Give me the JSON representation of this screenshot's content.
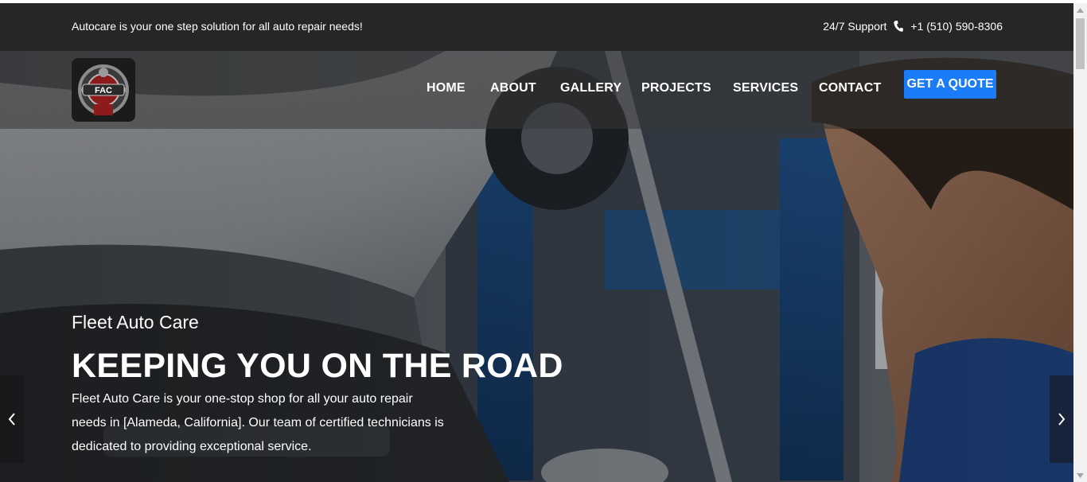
{
  "topbar": {
    "tagline": "Autocare is your one step solution for all auto repair needs!",
    "support_label": "24/7 Support",
    "phone": "+1 (510) 590-8306",
    "phone_icon": "phone-icon"
  },
  "header": {
    "logo_text": "FAC",
    "nav": {
      "home": "HOME",
      "about": "ABOUT",
      "gallery": "GALLERY",
      "projects": "PROJECTS",
      "services": "SERVICES",
      "contact": "CONTACT"
    },
    "cta": "GET A QUOTE"
  },
  "hero": {
    "kicker": "Fleet Auto Care",
    "headline": "KEEPING YOU ON THE ROAD",
    "description": "Fleet Auto Care is your one-stop shop for all your auto repair needs in [Alameda, California]. Our team of certified technicians is dedicated to providing exceptional service.",
    "prev_icon": "chevron-left-icon",
    "next_icon": "chevron-right-icon"
  },
  "colors": {
    "topbar_bg": "#262626",
    "cta_bg": "#1a7cf7",
    "text": "#ffffff"
  }
}
